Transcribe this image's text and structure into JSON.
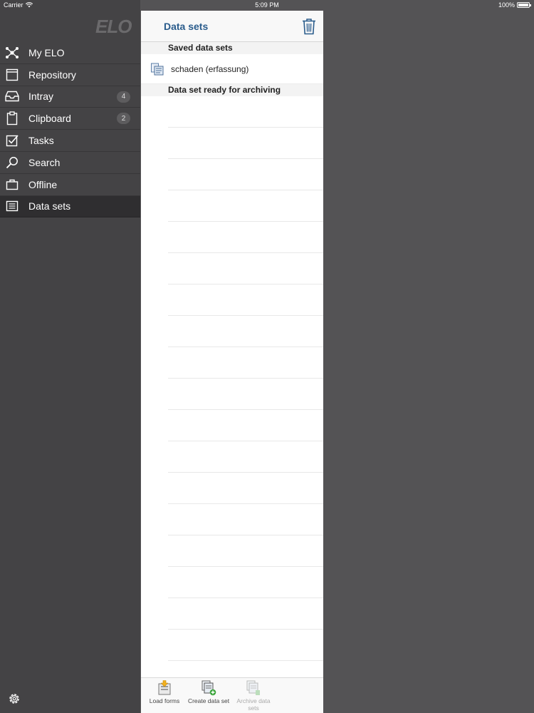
{
  "status_bar": {
    "carrier": "Carrier",
    "time": "5:09 PM",
    "battery": "100%"
  },
  "sidebar": {
    "logo": "ELO",
    "items": [
      {
        "label": "My ELO",
        "icon": "network-icon",
        "badge": ""
      },
      {
        "label": "Repository",
        "icon": "repository-icon",
        "badge": ""
      },
      {
        "label": "Intray",
        "icon": "intray-icon",
        "badge": "4"
      },
      {
        "label": "Clipboard",
        "icon": "clipboard-icon",
        "badge": "2"
      },
      {
        "label": "Tasks",
        "icon": "tasks-icon",
        "badge": ""
      },
      {
        "label": "Search",
        "icon": "search-icon",
        "badge": ""
      },
      {
        "label": "Offline",
        "icon": "offline-icon",
        "badge": ""
      },
      {
        "label": "Data sets",
        "icon": "data-sets-icon",
        "badge": ""
      }
    ],
    "active_item": "Data sets",
    "settings_icon": "gear-icon"
  },
  "panel": {
    "title": "Data sets",
    "trash_icon": "trash-icon",
    "sections": [
      {
        "header": "Saved data sets",
        "items": [
          "schaden (erfassung)"
        ]
      },
      {
        "header": "Data set ready for archiving",
        "items": []
      }
    ]
  },
  "toolbar": {
    "load_forms": "Load forms",
    "create_data_set": "Create data set",
    "archive_data_sets": "Archive data sets"
  },
  "colors": {
    "accent": "#2a5c8c",
    "sidebar_bg": "#444345",
    "sidebar_active": "#2f2e30",
    "background": "#545355"
  }
}
